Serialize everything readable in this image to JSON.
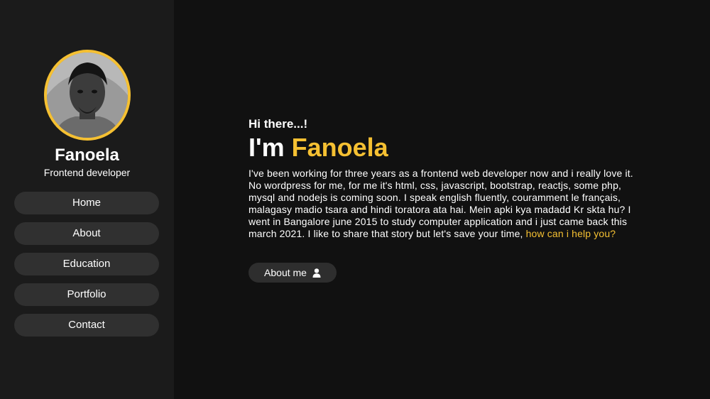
{
  "profile": {
    "name": "Fanoela",
    "role": "Frontend developer",
    "avatar_icon": "profile-photo",
    "accent_color": "#f5c032"
  },
  "sidebar": {
    "items": [
      {
        "label": "Home"
      },
      {
        "label": "About"
      },
      {
        "label": "Education"
      },
      {
        "label": "Portfolio"
      },
      {
        "label": "Contact"
      }
    ]
  },
  "hero": {
    "greeting": "Hi there...!",
    "headline_prefix": "I'm ",
    "headline_name": "Fanoela",
    "bio": "I've been working for three years as a frontend web developer now and i really love it. No wordpress for me, for me it's html, css, javascript, bootstrap, reactjs, some php, mysql and nodejs is coming soon. I speak english fluently, couramment le français, malagasy madio tsara and hindi toratora ata hai. Mein apki kya madadd Kr skta hu? I went in Bangalore june 2015 to study computer application and i just came back this march 2021. I like to share that story but let's save your time, ",
    "help_link": "how can i help you?",
    "about_button": "About me",
    "about_button_icon": "user-icon"
  }
}
